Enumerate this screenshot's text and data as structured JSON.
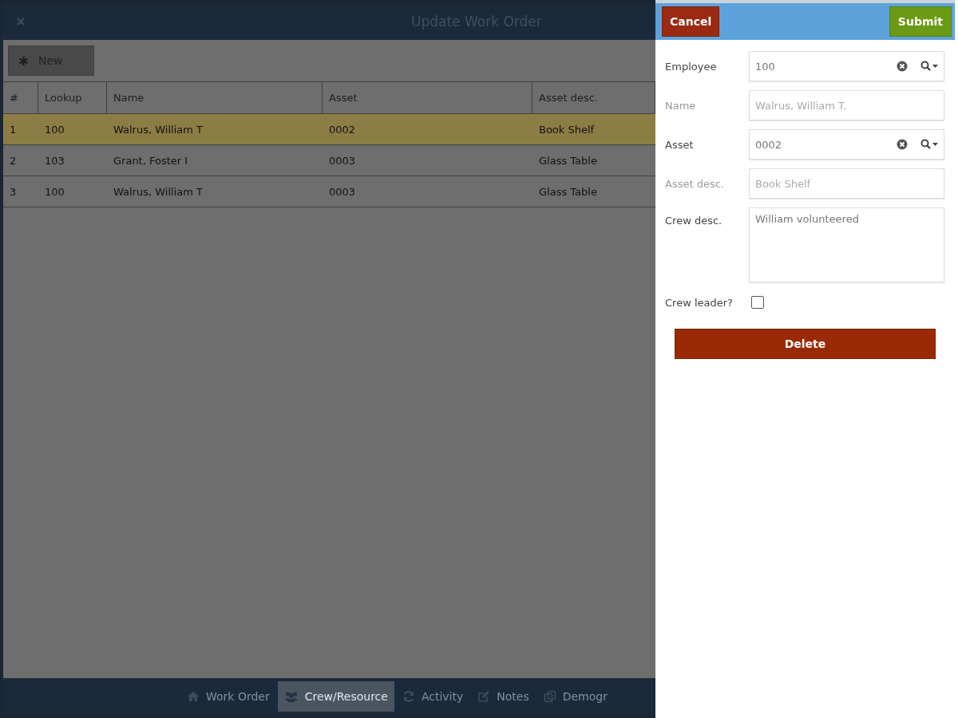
{
  "window": {
    "title": "Update Work Order"
  },
  "toolbar": {
    "new_button": "New"
  },
  "table": {
    "columns": [
      "#",
      "Lookup",
      "Name",
      "Asset",
      "Asset desc."
    ],
    "rows": [
      {
        "cells": [
          "1",
          "100",
          "Walrus, William T",
          "0002",
          "Book Shelf"
        ],
        "selected": true
      },
      {
        "cells": [
          "2",
          "103",
          "Grant, Foster I",
          "0003",
          "Glass Table"
        ],
        "selected": false
      },
      {
        "cells": [
          "3",
          "100",
          "Walrus, William T",
          "0003",
          "Glass Table"
        ],
        "selected": false
      }
    ]
  },
  "tabs": [
    {
      "label": "Work Order",
      "selected": false
    },
    {
      "label": "Crew/Resource",
      "selected": true
    },
    {
      "label": "Activity",
      "selected": false
    },
    {
      "label": "Notes",
      "selected": false
    },
    {
      "label": "Demogr",
      "selected": false
    }
  ],
  "panel": {
    "cancel": "Cancel",
    "submit": "Submit",
    "fields": [
      {
        "kind": "lookup",
        "label": "Employee",
        "value": "100",
        "disabled": false
      },
      {
        "kind": "text",
        "label": "Name",
        "value": "Walrus, William T.",
        "disabled": true
      },
      {
        "kind": "lookup",
        "label": "Asset",
        "value": "0002",
        "disabled": false
      },
      {
        "kind": "text",
        "label": "Asset desc.",
        "value": "Book Shelf",
        "disabled": true
      },
      {
        "kind": "textarea",
        "label": "Crew desc.",
        "value": "William volunteered",
        "disabled": false
      },
      {
        "kind": "checkbox",
        "label": "Crew leader?",
        "checked": false,
        "disabled": false
      }
    ],
    "delete": "Delete"
  }
}
